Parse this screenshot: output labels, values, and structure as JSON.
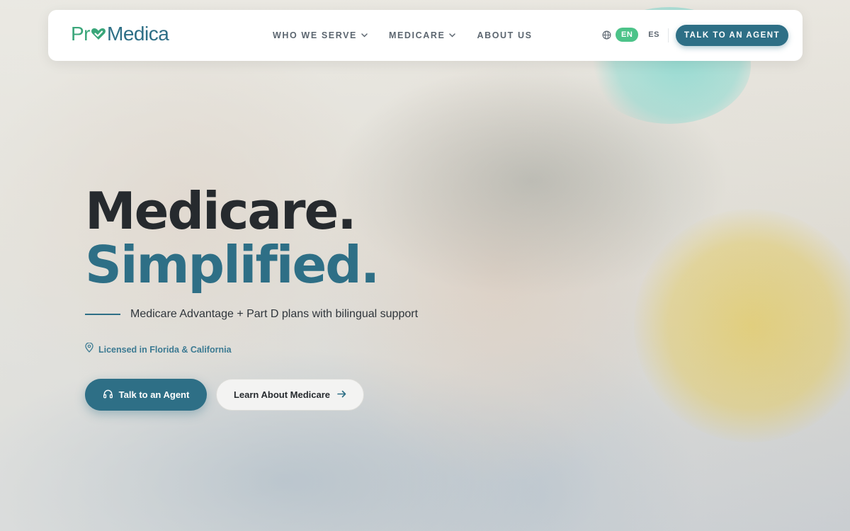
{
  "brand": {
    "name_part1": "Pr",
    "name_part2": "Medica",
    "logo_icon": "heart-check-icon",
    "colors": {
      "green": "#3aa67a",
      "teal": "#2e6f86",
      "accent_green": "#4cc389"
    }
  },
  "nav": {
    "links": [
      {
        "label": "WHO WE SERVE",
        "has_dropdown": true
      },
      {
        "label": "MEDICARE",
        "has_dropdown": true
      },
      {
        "label": "ABOUT US",
        "has_dropdown": false
      }
    ],
    "language": {
      "icon": "globe-icon",
      "options": [
        "EN",
        "ES"
      ],
      "selected": "EN"
    },
    "cta_label": "TALK TO AN AGENT"
  },
  "hero": {
    "headline_line1": "Medicare.",
    "headline_line2": "Simplified.",
    "tagline": "Medicare Advantage + Part D plans with bilingual support",
    "license_icon": "map-pin-icon",
    "license_text": "Licensed in Florida & California",
    "primary_button": {
      "label": "Talk to an Agent",
      "icon": "headset-icon"
    },
    "secondary_button": {
      "label": "Learn About Medicare",
      "icon": "arrow-right-icon"
    }
  }
}
